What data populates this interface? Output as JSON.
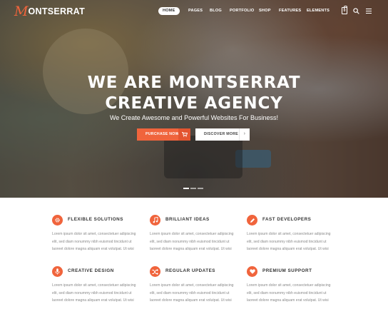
{
  "brand": {
    "logo_letter": "M",
    "logo_text": "ONTSERRAT",
    "accent_color": "#f0643c"
  },
  "nav": {
    "items": [
      {
        "label": "HOME",
        "active": true
      },
      {
        "label": "PAGES"
      },
      {
        "label": "BLOG"
      },
      {
        "label": "PORTFOLIO"
      },
      {
        "label": "SHOP"
      },
      {
        "label": "FEATURES"
      },
      {
        "label": "ELEMENTS"
      }
    ],
    "cart_count": "0",
    "icons": [
      "cart-icon",
      "search-icon",
      "menu-icon"
    ]
  },
  "hero": {
    "title_line1": "WE ARE MONTSERRAT",
    "title_line2": "CREATIVE AGENCY",
    "subtitle": "We Create Awesome and Powerful Websites For Business!",
    "primary_button": {
      "label": "PURCHASE NOW",
      "icon": "cart-icon"
    },
    "secondary_button": {
      "label": "DISCOVER MORE",
      "icon": "chevron-right-icon"
    },
    "slides": {
      "count": 3,
      "active_index": 0
    }
  },
  "features": [
    {
      "title": "FLEXIBLE SOLUTIONS",
      "icon": "gear-icon",
      "text": "Lorem ipsum dolor sit amet, consectetuer adipiscing elit, sed diam nonummy nibh euismod tincidunt ut laoreet dolore magna aliquam erat volutpat. Ut wisi"
    },
    {
      "title": "BRILLIANT IDEAS",
      "icon": "music-note-icon",
      "text": "Lorem ipsum dolor sit amet, consectetuer adipiscing elit, sed diam nonummy nibh euismod tincidunt ut laoreet dolore magna aliquam erat volutpat. Ut wisi"
    },
    {
      "title": "FAST DEVELOPERS",
      "icon": "pencil-icon",
      "text": "Lorem ipsum dolor sit amet, consectetuer adipiscing elit, sed diam nonummy nibh euismod tincidunt ut laoreet dolore magna aliquam erat volutpat. Ut wisi"
    },
    {
      "title": "CREATIVE DESIGN",
      "icon": "microphone-icon",
      "text": "Lorem ipsum dolor sit amet, consectetuer adipiscing elit, sed diam nonummy nibh euismod tincidunt ut laoreet dolore magna aliquam erat volutpat. Ut wisi"
    },
    {
      "title": "REGULAR UPDATES",
      "icon": "shuffle-icon",
      "text": "Lorem ipsum dolor sit amet, consectetuer adipiscing elit, sed diam nonummy nibh euismod tincidunt ut laoreet dolore magna aliquam erat volutpat. Ut wisi"
    },
    {
      "title": "PREMIUM SUPPORT",
      "icon": "heart-icon",
      "text": "Lorem ipsum dolor sit amet, consectetuer adipiscing elit, sed diam nonummy nibh euismod tincidunt ut laoreet dolore magna aliquam erat volutpat. Ut wisi"
    }
  ]
}
